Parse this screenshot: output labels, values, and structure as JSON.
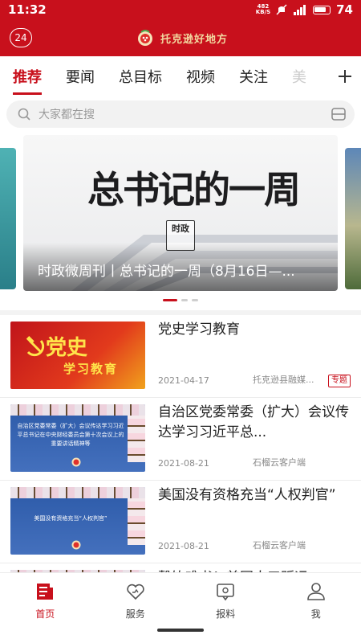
{
  "status_bar": {
    "time": "11:32",
    "net_speed_value": "482",
    "net_speed_unit": "KB/S",
    "battery_percent": "74"
  },
  "header": {
    "weather_badge": "24",
    "logo_text": "托克逊好地方"
  },
  "tabs": [
    {
      "label": "推荐",
      "active": true
    },
    {
      "label": "要闻"
    },
    {
      "label": "总目标"
    },
    {
      "label": "视频"
    },
    {
      "label": "关注"
    },
    {
      "label": "美"
    }
  ],
  "search": {
    "placeholder": "大家都在搜"
  },
  "carousel": {
    "art_title": "总书记的一周",
    "emblem_text": "时政",
    "caption": "时政微周刊丨总书记的一周（8月16日—...",
    "dot_count": 3,
    "active_dot": 0
  },
  "news": [
    {
      "title": "党史学习教育",
      "date": "2021-04-17",
      "source": "托克逊县融媒...",
      "badge": "专题",
      "thumb_big": "党史",
      "thumb_small": "学习教育"
    },
    {
      "title": "自治区党委常委（扩大）会议传达学习习近平总...",
      "date": "2021-08-21",
      "source": "石榴云客户端",
      "thumb_text": "自治区党委常委（扩大）会议传达学习习近平总书记在中央财经委员会第十次会议上的重要讲话精神等"
    },
    {
      "title": "美国没有资格充当“人权判官”",
      "date": "2021-08-21",
      "source": "石榴云客户端",
      "thumb_text": "美国没有资格充当“人权判官”"
    },
    {
      "title": "聲饮难书！美国人口贩运"
    }
  ],
  "bottom_nav": [
    {
      "label": "首页",
      "icon": "home-news-icon",
      "active": true
    },
    {
      "label": "服务",
      "icon": "heart-service-icon"
    },
    {
      "label": "报料",
      "icon": "report-chat-icon"
    },
    {
      "label": "我",
      "icon": "person-icon"
    }
  ],
  "colors": {
    "brand_red": "#c8101c",
    "gold": "#f2d9a0"
  }
}
